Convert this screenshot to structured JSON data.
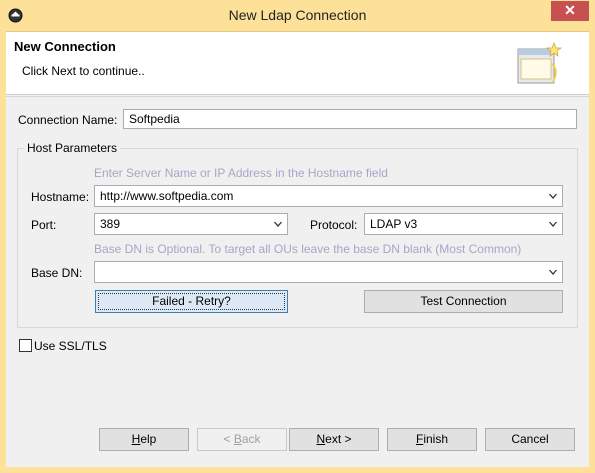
{
  "window": {
    "title": "New Ldap Connection",
    "close_glyph": "✕",
    "frame_color": "#fde199"
  },
  "header": {
    "title": "New Connection",
    "subtitle": "Click Next to continue.."
  },
  "form": {
    "connection_name_label": "Connection Name:",
    "connection_name_value": "Softpedia",
    "group_title": "Host Parameters",
    "host_hint": "Enter Server Name or IP Address in the Hostname field",
    "hostname_label": "Hostname:",
    "hostname_value": "http://www.softpedia.com",
    "port_label": "Port:",
    "port_value": "389",
    "protocol_label": "Protocol:",
    "protocol_value": "LDAP v3",
    "basedn_hint": "Base DN is Optional. To target all OUs leave the base DN blank (Most Common)",
    "basedn_label": "Base DN:",
    "basedn_value": "",
    "failed_button": "Failed - Retry?",
    "test_button": "Test Connection",
    "ssl_label": "Use SSL/TLS",
    "ssl_checked": false
  },
  "footer": {
    "help": {
      "mnemonic": "H",
      "rest": "elp"
    },
    "back": {
      "prefix": "< ",
      "mnemonic": "B",
      "rest": "ack"
    },
    "next": {
      "mnemonic": "N",
      "rest": "ext >"
    },
    "finish": {
      "mnemonic": "F",
      "rest": "inish"
    },
    "cancel": "Cancel"
  },
  "icons": {
    "system_menu": "circle-arrow-icon",
    "wizard": "wizard-window-icon",
    "dropdown": "chevron-down-icon"
  }
}
